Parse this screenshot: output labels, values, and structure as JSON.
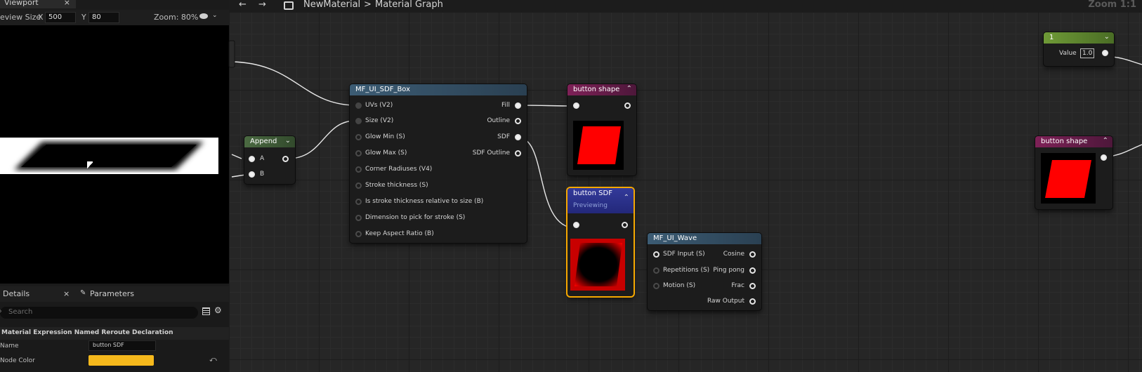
{
  "viewport": {
    "tab_label": "Viewport",
    "close_glyph": "×",
    "preview_size_label": "eview Size",
    "x_label": "X",
    "x_value": "500",
    "y_label": "Y",
    "y_value": "80",
    "zoom_text": "Zoom: 80%",
    "eye_icon": "eye-icon"
  },
  "details": {
    "tab_label": "Details",
    "close_glyph": "×",
    "params_tab_label": "Parameters",
    "search_placeholder": "Search",
    "section_title": "Material Expression Named Reroute Declaration",
    "name_label": "Name",
    "name_value": "button SDF",
    "node_color_label": "Node Color",
    "node_color": "#f6b91c"
  },
  "graph": {
    "back_glyph": "←",
    "forward_glyph": "→",
    "breadcrumb_root": "NewMaterial",
    "breadcrumb_sep": ">",
    "breadcrumb_leaf": "Material Graph",
    "zoom_label": "Zoom 1:1"
  },
  "nodes": {
    "append": {
      "title": "Append",
      "pin_a": "A",
      "pin_b": "B"
    },
    "sdf_box": {
      "title": "MF_UI_SDF_Box",
      "inputs": [
        "UVs (V2)",
        "Size (V2)",
        "Glow Min (S)",
        "Glow Max (S)",
        "Corner Radiuses (V4)",
        "Stroke thickness (S)",
        "Is stroke thickness relative to size (B)",
        "Dimension to pick for stroke (S)",
        "Keep Aspect Ratio (B)"
      ],
      "outputs": [
        "Fill",
        "Outline",
        "SDF",
        "SDF Outline"
      ]
    },
    "button_shape": {
      "title": "button shape"
    },
    "button_sdf": {
      "title": "button SDF",
      "status": "Previewing"
    },
    "ui_wave": {
      "title": "MF_UI_Wave",
      "inputs": [
        "SDF Input (S)",
        "Repetitions (S)",
        "Motion (S)"
      ],
      "outputs": [
        "Cosine",
        "Ping pong",
        "Frac",
        "Raw Output"
      ]
    },
    "constant": {
      "title": "1",
      "value_label": "Value",
      "value": "1.0"
    },
    "button_shape_right": {
      "title": "button shape"
    }
  },
  "colors": {
    "accent_selected": "#f6a800",
    "preview_red": "#ff0000"
  }
}
